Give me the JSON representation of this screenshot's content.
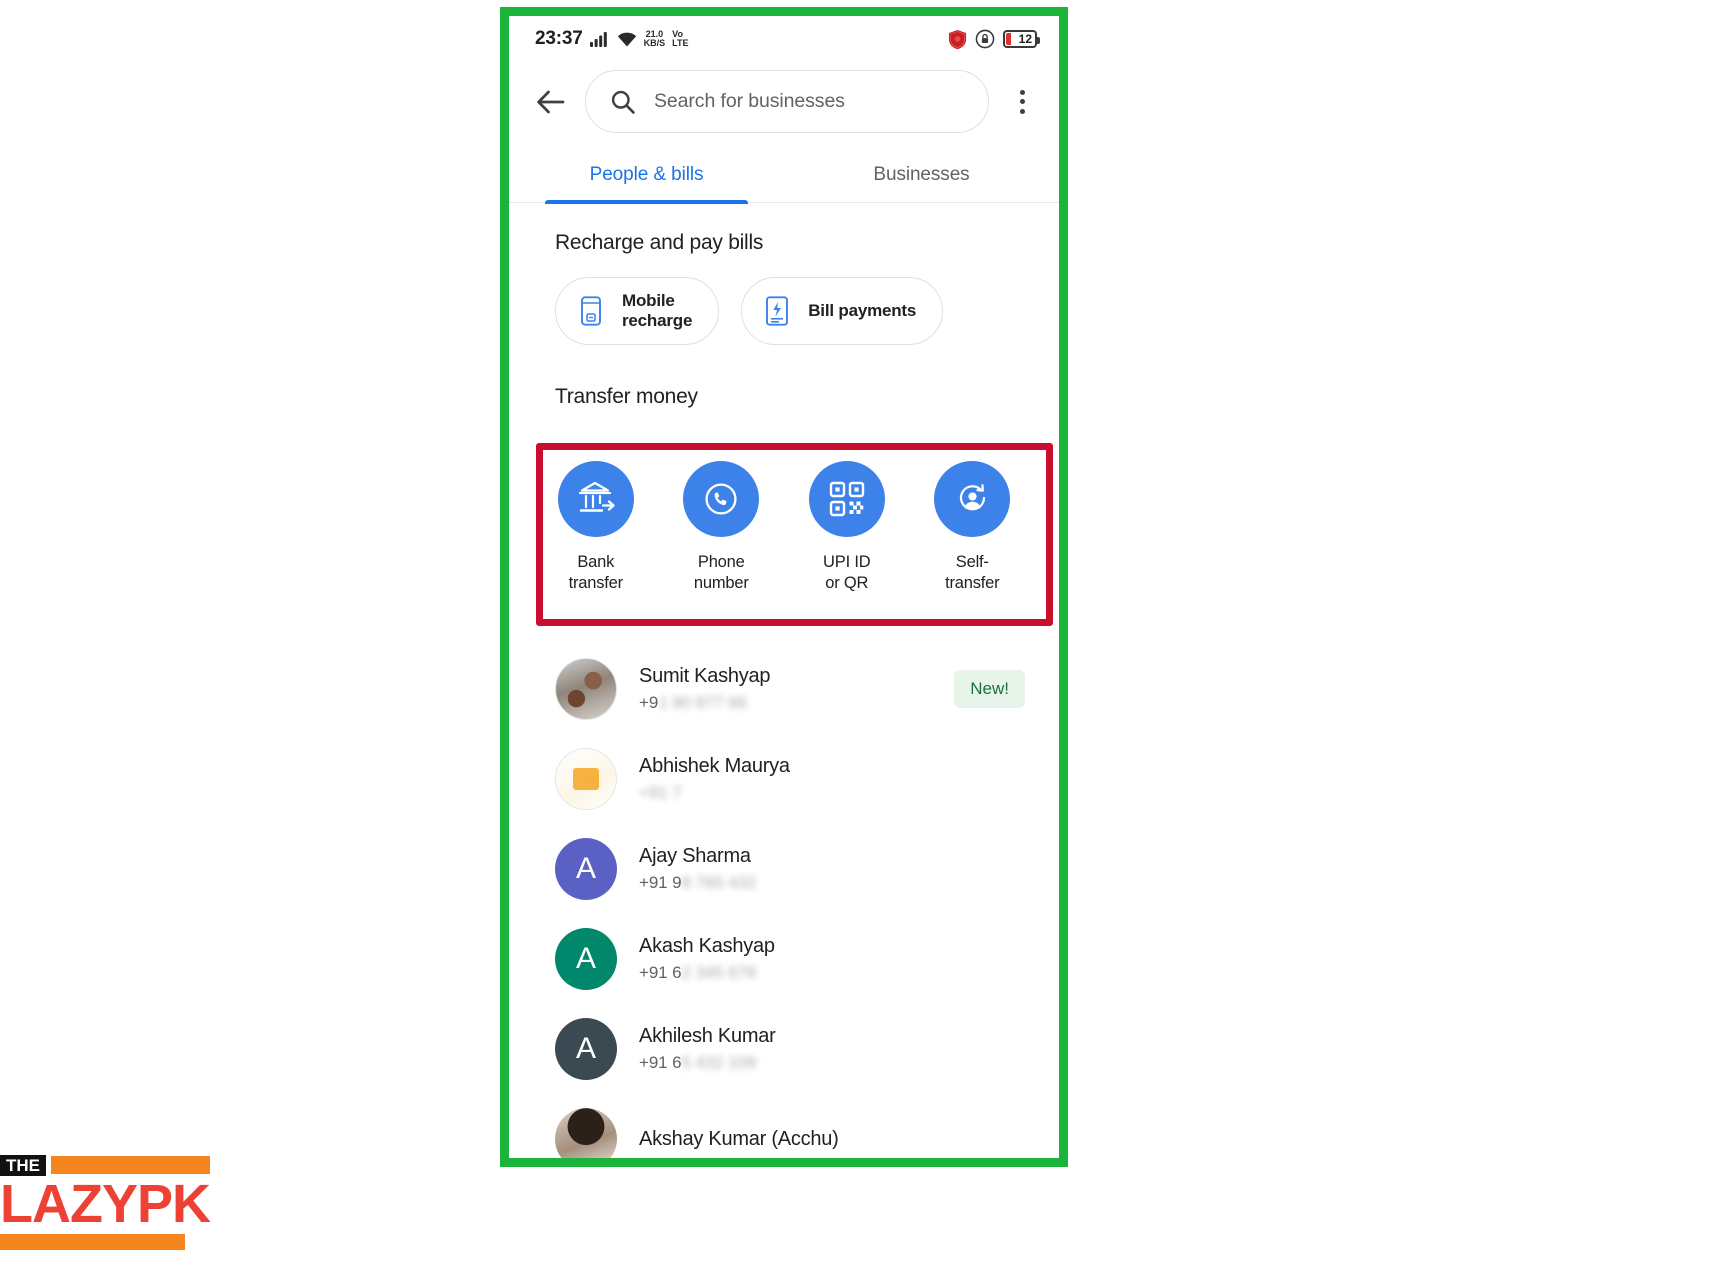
{
  "status_bar": {
    "time": "23:37",
    "net_speed_value": "21.0",
    "net_speed_unit": "KB/S",
    "volte_top": "Vo",
    "volte_bottom": "LTE",
    "battery_percent": "12",
    "icons": [
      "signal-icon",
      "wifi-icon",
      "shield-icon",
      "silent-mode-icon",
      "battery-icon"
    ]
  },
  "header": {
    "back_label": "Back",
    "search_placeholder": "Search for businesses",
    "search_value": "",
    "menu_label": "More options"
  },
  "tabs": [
    {
      "label": "People & bills",
      "active": true
    },
    {
      "label": "Businesses",
      "active": false
    }
  ],
  "recharge": {
    "title": "Recharge and pay bills",
    "chips": [
      {
        "label": "Mobile\nrecharge",
        "line1": "Mobile",
        "line2": "recharge",
        "icon": "mobile-phone-icon"
      },
      {
        "label": "Bill payments",
        "line1": "Bill payments",
        "line2": "",
        "icon": "bill-document-icon"
      }
    ]
  },
  "transfer": {
    "title": "Transfer money",
    "highlight_color": "#C8102E",
    "accent_color": "#3D82E9",
    "actions": [
      {
        "line1": "Bank",
        "line2": "transfer",
        "icon": "bank-transfer-icon"
      },
      {
        "line1": "Phone",
        "line2": "number",
        "icon": "phone-circle-icon"
      },
      {
        "line1": "UPI ID",
        "line2": "or QR",
        "icon": "qr-code-icon"
      },
      {
        "line1": "Self-",
        "line2": "transfer",
        "icon": "self-transfer-person-icon"
      }
    ]
  },
  "contacts": [
    {
      "name": "Sumit Kashyap",
      "sub_prefix": "+9",
      "sub_redacted": "1 90 877 66",
      "avatar_type": "photo",
      "avatar_class": "photo-a",
      "avatar_initial": "",
      "avatar_color": "",
      "badge": "New!"
    },
    {
      "name": "Abhishek Maurya",
      "sub_prefix": "",
      "sub_redacted": "+91 7",
      "avatar_type": "photo",
      "avatar_class": "photo-b",
      "avatar_initial": "",
      "avatar_color": "",
      "badge": ""
    },
    {
      "name": "Ajay Sharma",
      "sub_prefix": "+91 9",
      "sub_redacted": "8 765 432",
      "avatar_type": "initial",
      "avatar_class": "",
      "avatar_initial": "A",
      "avatar_color": "#5B60C4",
      "badge": ""
    },
    {
      "name": "Akash Kashyap",
      "sub_prefix": "+91 6",
      "sub_redacted": "2 345 678",
      "avatar_type": "initial",
      "avatar_class": "",
      "avatar_initial": "A",
      "avatar_color": "#00876C",
      "badge": ""
    },
    {
      "name": "Akhilesh Kumar",
      "sub_prefix": "+91 6",
      "sub_redacted": "5 432 109",
      "avatar_type": "initial",
      "avatar_class": "",
      "avatar_initial": "A",
      "avatar_color": "#3B4A52",
      "badge": ""
    },
    {
      "name": "Akshay Kumar (Acchu)",
      "sub_prefix": "",
      "sub_redacted": "",
      "avatar_type": "photo",
      "avatar_class": "photo-c",
      "avatar_initial": "",
      "avatar_color": "",
      "badge": ""
    }
  ],
  "watermark": {
    "top_word": "THE",
    "main_word": "LAZYPK",
    "accent_color": "#F5861F",
    "main_color": "#EE4136"
  },
  "frame": {
    "border_color": "#1DB43B"
  }
}
